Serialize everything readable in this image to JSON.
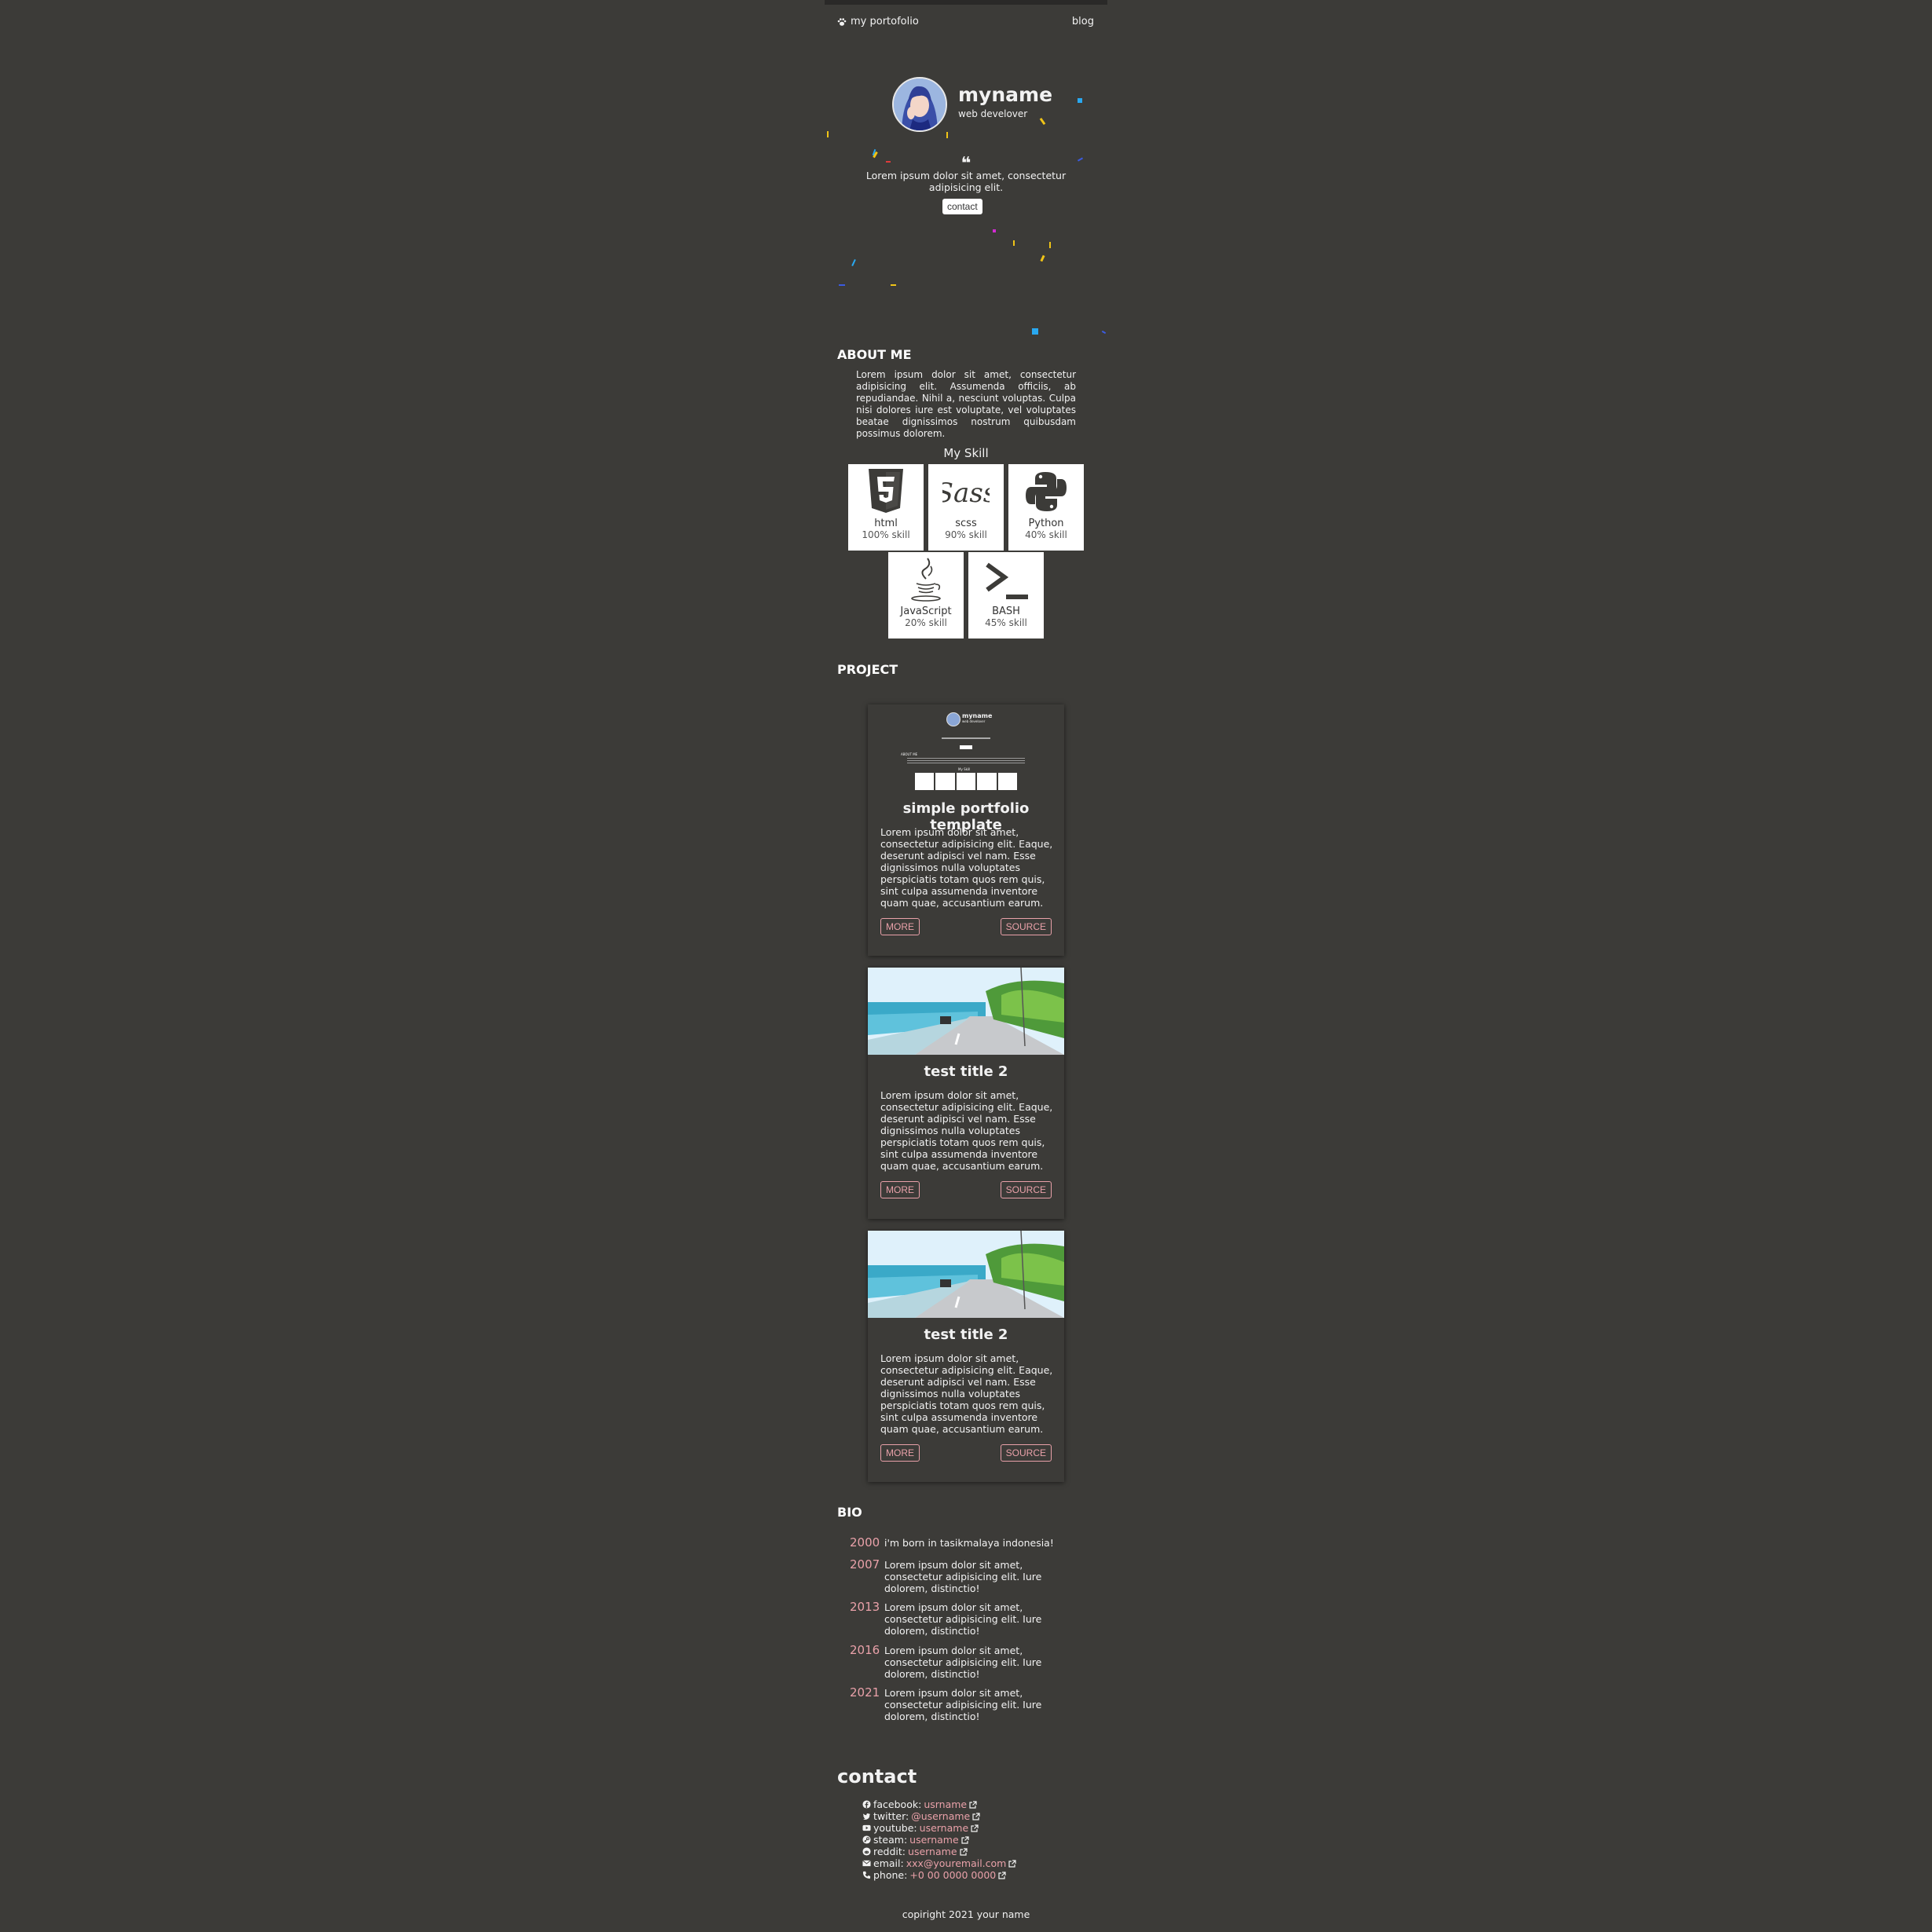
{
  "nav": {
    "brand": "my portofolio",
    "blog": "blog"
  },
  "hero": {
    "name": "myname",
    "role": "web develover",
    "quote": "Lorem ipsum dolor sit amet, consectetur adipisicing elit.",
    "contact_button": "contact"
  },
  "about": {
    "heading": "ABOUT ME",
    "text": "Lorem ipsum dolor sit amet, consectetur adipisicing elit. Assumenda officiis, ab repudiandae. Nihil a, nesciunt voluptas. Culpa nisi dolores iure est voluptate, vel voluptates beatae dignissimos nostrum quibusdam possimus dolorem.",
    "skill_title": "My Skill",
    "skills": [
      {
        "name": "html",
        "level": "100% skill",
        "icon": "html5-icon"
      },
      {
        "name": "scss",
        "level": "90% skill",
        "icon": "sass-icon"
      },
      {
        "name": "Python",
        "level": "40% skill",
        "icon": "python-icon"
      },
      {
        "name": "JavaScript",
        "level": "20% skill",
        "icon": "java-cup-icon"
      },
      {
        "name": "BASH",
        "level": "45% skill",
        "icon": "terminal-icon"
      }
    ]
  },
  "project": {
    "heading": "PROJECT",
    "cards": [
      {
        "title": "simple portfolio template",
        "text": "Lorem ipsum dolor sit amet, consectetur adipisicing elit. Eaque, deserunt adipisci vel nam. Esse dignissimos nulla voluptates perspiciatis totam quos rem quis, sint culpa assumenda inventore quam quae, accusantium earum.",
        "more": "MORE",
        "source": "SOURCE",
        "thumb": {
          "name": "myname",
          "role": "web develover",
          "about": "ABOUT ME",
          "skill": "My Skill"
        }
      },
      {
        "title": "test title 2",
        "text": "Lorem ipsum dolor sit amet, consectetur adipisicing elit. Eaque, deserunt adipisci vel nam. Esse dignissimos nulla voluptates perspiciatis totam quos rem quis, sint culpa assumenda inventore quam quae, accusantium earum.",
        "more": "MORE",
        "source": "SOURCE"
      },
      {
        "title": "test title 2",
        "text": "Lorem ipsum dolor sit amet, consectetur adipisicing elit. Eaque, deserunt adipisci vel nam. Esse dignissimos nulla voluptates perspiciatis totam quos rem quis, sint culpa assumenda inventore quam quae, accusantium earum.",
        "more": "MORE",
        "source": "SOURCE"
      }
    ]
  },
  "bio": {
    "heading": "BIO",
    "entries": [
      {
        "year": "2000",
        "text": "i'm born in tasikmalaya indonesia!"
      },
      {
        "year": "2007",
        "text": "Lorem ipsum dolor sit amet, consectetur adipisicing elit. Iure dolorem, distinctio!"
      },
      {
        "year": "2013",
        "text": "Lorem ipsum dolor sit amet, consectetur adipisicing elit. Iure dolorem, distinctio!"
      },
      {
        "year": "2016",
        "text": "Lorem ipsum dolor sit amet, consectetur adipisicing elit. Iure dolorem, distinctio!"
      },
      {
        "year": "2021",
        "text": "Lorem ipsum dolor sit amet, consectetur adipisicing elit. Iure dolorem, distinctio!"
      }
    ]
  },
  "contact": {
    "heading": "contact",
    "items": [
      {
        "label": "facebook:",
        "value": "usrname",
        "icon": "facebook-icon"
      },
      {
        "label": "twitter:",
        "value": "@username",
        "icon": "twitter-icon"
      },
      {
        "label": "youtube:",
        "value": "username",
        "icon": "youtube-icon"
      },
      {
        "label": "steam:",
        "value": "username",
        "icon": "steam-icon"
      },
      {
        "label": "reddit:",
        "value": "username",
        "icon": "reddit-icon"
      },
      {
        "label": "email:",
        "value": "xxx@youremail.com",
        "icon": "envelope-icon"
      },
      {
        "label": "phone:",
        "value": "+0 00 0000 0000",
        "icon": "phone-icon"
      }
    ]
  },
  "footer": {
    "text": "copiright 2021 your name"
  },
  "colors": {
    "background": "#3c3b38",
    "accent": "#e9a1a9",
    "text": "#f2f2f2",
    "card_light": "#ffffff"
  }
}
